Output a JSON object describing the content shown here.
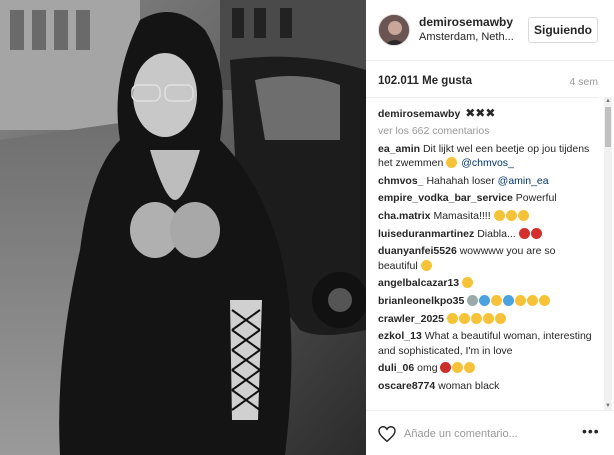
{
  "post": {
    "username": "demirosemawby",
    "location": "Amsterdam, Neth...",
    "follow_label": "Siguiendo",
    "likes": "102.011 Me gusta",
    "time": "4 sem"
  },
  "caption": {
    "username": "demirosemawby",
    "emoji": "✖✖✖"
  },
  "view_more": "ver los 662 comentarios",
  "comments": [
    {
      "user": "ea_amin",
      "text": "Dit lijkt wel een beetje op jou tijdens het zwemmen",
      "mention": "@chmvos_",
      "emojis": [
        "y"
      ]
    },
    {
      "user": "chmvos_",
      "text": "Hahahah loser",
      "mention": "@amin_ea",
      "emojis": []
    },
    {
      "user": "empire_vodka_bar_service",
      "text": "Powerful",
      "mention": "",
      "emojis": []
    },
    {
      "user": "cha.matrix",
      "text": "Mamasita!!!!",
      "mention": "",
      "emojis": [
        "y",
        "y",
        "y"
      ]
    },
    {
      "user": "luiseduranmartinez",
      "text": "Diabla...",
      "mention": "",
      "emojis": [
        "r",
        "r"
      ]
    },
    {
      "user": "duanyanfei5526",
      "text": "wowwww you are so beautiful",
      "mention": "",
      "emojis": [
        "y"
      ]
    },
    {
      "user": "angelbalcazar13",
      "text": "",
      "mention": "",
      "emojis": [
        "y"
      ]
    },
    {
      "user": "brianleonelkpo35",
      "text": "",
      "mention": "",
      "emojis": [
        "g",
        "b",
        "y",
        "b",
        "y",
        "y",
        "y"
      ]
    },
    {
      "user": "crawler_2025",
      "text": "",
      "mention": "",
      "emojis": [
        "y",
        "y",
        "y",
        "y",
        "y"
      ]
    },
    {
      "user": "ezkol_13",
      "text": "What a beautiful woman, interesting and sophisticated, I'm in love",
      "mention": "",
      "emojis": []
    },
    {
      "user": "duli_06",
      "text": "omg",
      "mention": "",
      "emojis": [
        "c",
        "y",
        "y"
      ]
    },
    {
      "user": "oscare8774",
      "text": "woman black",
      "mention": "",
      "emojis": []
    }
  ],
  "footer": {
    "comment_placeholder": "Añade un comentario...",
    "more_icon": "•••"
  },
  "icons": {
    "heart": "heart-outline-icon",
    "more": "more-options-icon"
  }
}
